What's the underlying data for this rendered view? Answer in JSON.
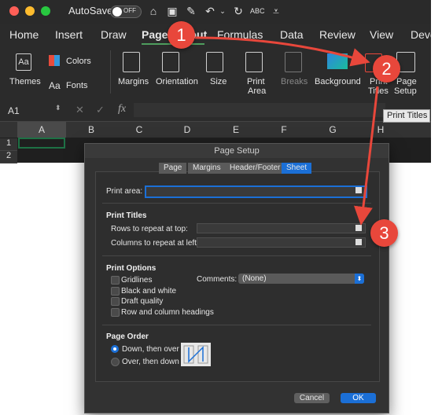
{
  "titlebar": {
    "autosave_label": "AutoSave",
    "autosave_state": "OFF"
  },
  "ribbon_tabs": [
    "Home",
    "Insert",
    "Draw",
    "Page Layout",
    "Formulas",
    "Data",
    "Review",
    "View",
    "Developer"
  ],
  "ribbon": {
    "themes": "Themes",
    "colors": "Colors",
    "fonts": "Fonts",
    "margins": "Margins",
    "orientation": "Orientation",
    "size": "Size",
    "print_area_1": "Print",
    "print_area_2": "Area",
    "breaks": "Breaks",
    "background": "Background",
    "print_titles_1": "Print",
    "print_titles_2": "Titles",
    "page_setup_1": "Page",
    "page_setup_2": "Setup"
  },
  "formula_bar": {
    "name_box": "A1",
    "fx": "fx"
  },
  "columns": [
    "A",
    "B",
    "C",
    "D",
    "E",
    "F",
    "G",
    "H"
  ],
  "rows": [
    "1",
    "2"
  ],
  "tooltip": "Print Titles",
  "dialog": {
    "title": "Page Setup",
    "tabs": [
      "Page",
      "Margins",
      "Header/Footer",
      "Sheet"
    ],
    "active_tab": "Sheet",
    "print_area_label": "Print area:",
    "print_titles_header": "Print Titles",
    "rows_repeat_label": "Rows to repeat at top:",
    "cols_repeat_label": "Columns to repeat at left:",
    "print_options_header": "Print Options",
    "gridlines": "Gridlines",
    "black_white": "Black and white",
    "draft": "Draft quality",
    "row_col_headings": "Row and column headings",
    "comments_label": "Comments:",
    "comments_value": "(None)",
    "page_order_header": "Page Order",
    "down_over": "Down, then over",
    "over_down": "Over, then down",
    "cancel": "Cancel",
    "ok": "OK"
  },
  "annotations": {
    "step1": "1",
    "step2": "2",
    "step3": "3"
  },
  "colors": {
    "accent": "#1b6fd6",
    "annotation": "#e8473b",
    "excel_green": "#1e7145"
  }
}
